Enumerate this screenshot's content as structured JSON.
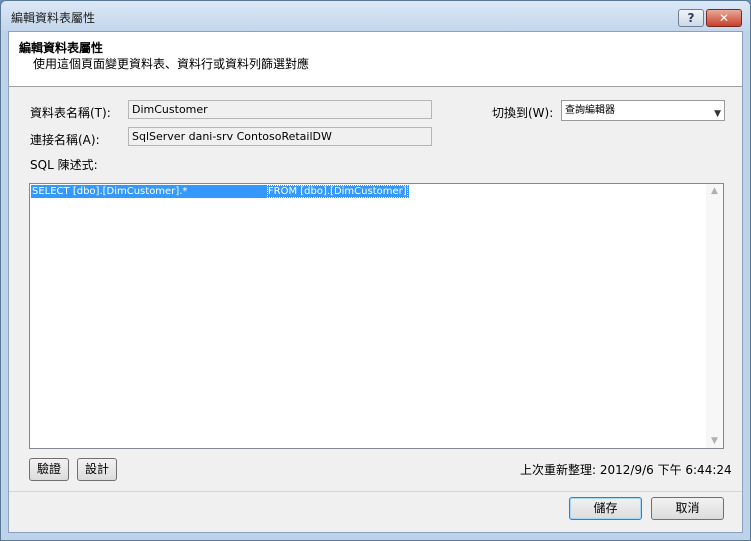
{
  "window": {
    "title": "編輯資料表屬性",
    "help_label": "?",
    "close_label": "✕"
  },
  "header": {
    "title": "編輯資料表屬性",
    "description": "使用這個頁面變更資料表、資料行或資料列篩選對應"
  },
  "form": {
    "table_name_label": "資料表名稱(T):",
    "table_name_value": "DimCustomer",
    "connection_label": "連接名稱(A):",
    "connection_value": "SqlServer dani-srv ContosoRetailDW",
    "switch_label": "切換到(W):",
    "switch_value": "查詢編輯器"
  },
  "sql": {
    "label": "SQL 陳述式:",
    "text_part1": "SELECT [dbo].[DimCustomer].*                         ",
    "text_part2": "FROM [dbo].[DimCustomer]"
  },
  "buttons": {
    "validate": "驗證",
    "design": "設計",
    "save": "儲存",
    "cancel": "取消"
  },
  "status": {
    "last_refresh": "上次重新整理: 2012/9/6 下午 6:44:24"
  }
}
